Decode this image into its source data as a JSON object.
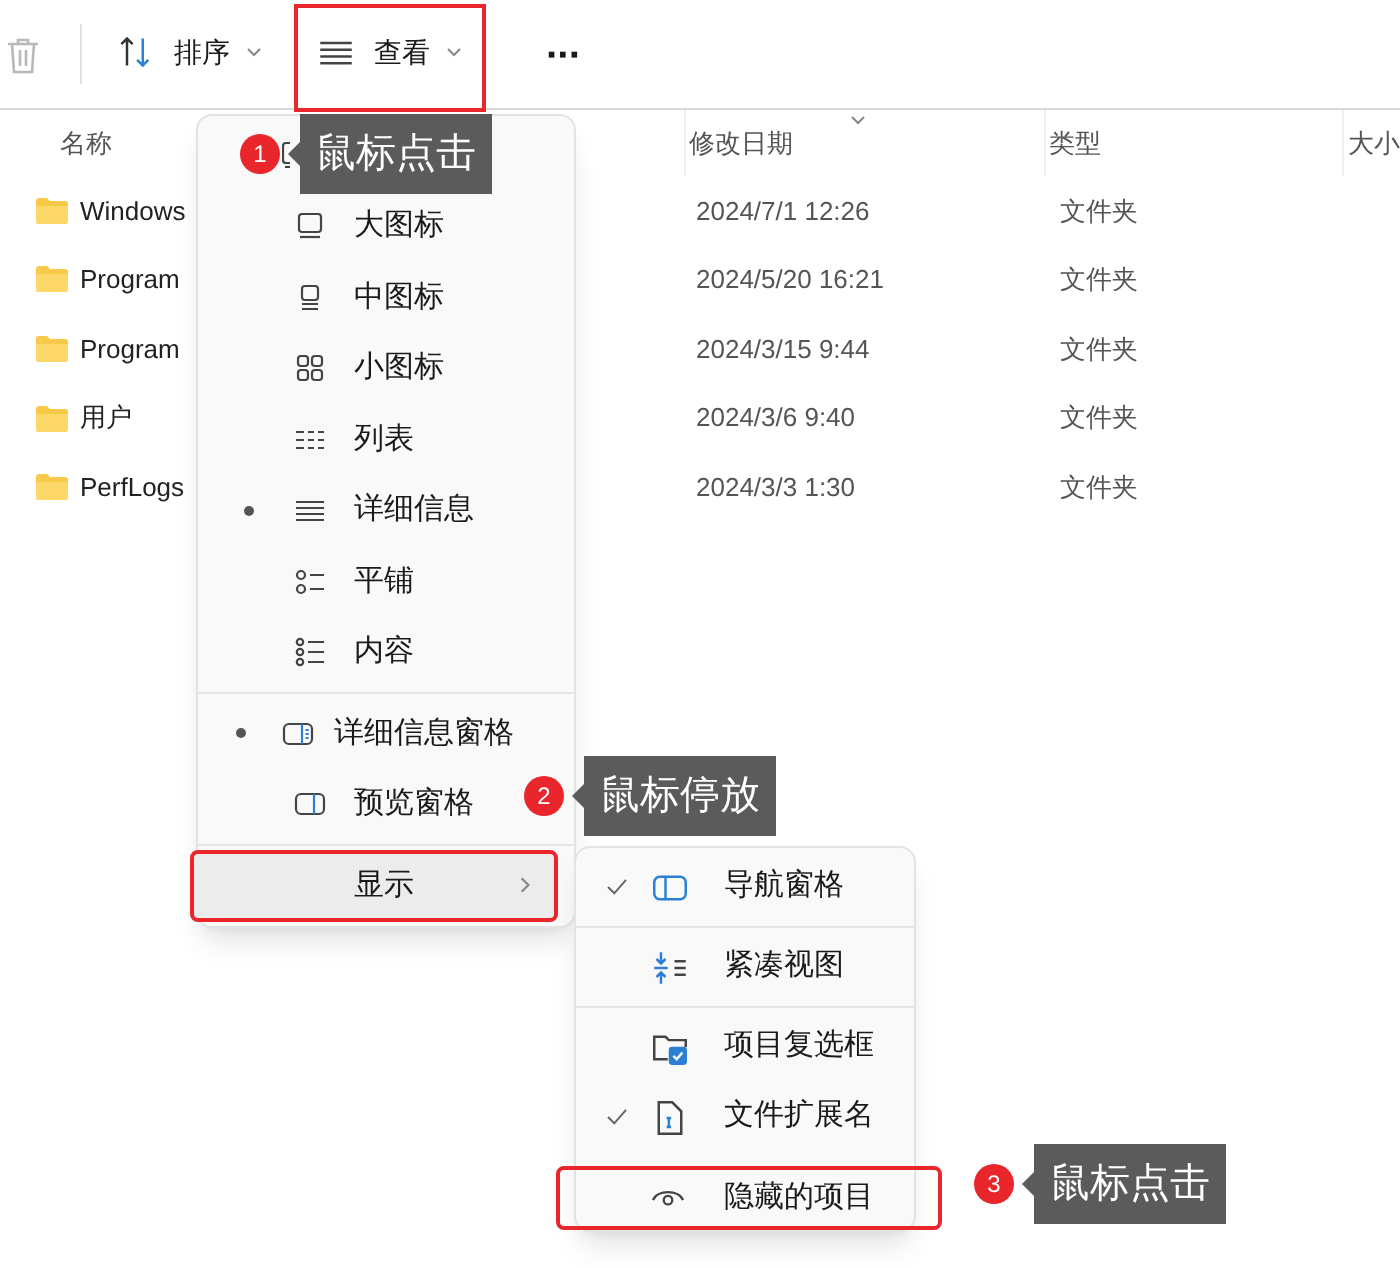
{
  "toolbar": {
    "buttons": [
      {
        "kind": "sort",
        "label": "排序",
        "highlighted": false
      },
      {
        "kind": "view",
        "label": "查看",
        "highlighted": true
      },
      {
        "kind": "more",
        "label": "···",
        "highlighted": false
      }
    ]
  },
  "table": {
    "columns": [
      {
        "label": "名称",
        "sorted": false
      },
      {
        "label": "修改日期",
        "sorted": true
      },
      {
        "label": "类型",
        "sorted": false
      },
      {
        "label": "大小",
        "sorted": false
      }
    ],
    "rows": [
      {
        "name": "Windows",
        "modified": "2024/7/1 12:26",
        "type": "文件夹"
      },
      {
        "name": "Program",
        "modified": "2024/5/20 16:21",
        "type": "文件夹"
      },
      {
        "name": "Program",
        "modified": "2024/3/15 9:44",
        "type": "文件夹"
      },
      {
        "name": "用户",
        "modified": "2024/3/6 9:40",
        "type": "文件夹"
      },
      {
        "name": "PerfLogs",
        "modified": "2024/3/3 1:30",
        "type": "文件夹"
      }
    ]
  },
  "view_menu": {
    "groups": [
      {
        "items": [
          {
            "kind": "extra-large"
          },
          {
            "kind": "large",
            "label": "大图标",
            "selected": false
          },
          {
            "kind": "medium",
            "label": "中图标",
            "selected": false
          },
          {
            "kind": "small",
            "label": "小图标",
            "selected": false
          },
          {
            "kind": "list",
            "label": "列表",
            "selected": false
          },
          {
            "kind": "details",
            "label": "详细信息",
            "selected": true
          },
          {
            "kind": "tiles",
            "label": "平铺",
            "selected": false
          },
          {
            "kind": "content",
            "label": "内容",
            "selected": false
          }
        ]
      },
      {
        "items": [
          {
            "kind": "details-pane",
            "label": "详细信息窗格",
            "selected": true
          },
          {
            "kind": "preview-pane",
            "label": "预览窗格",
            "selected": false
          }
        ]
      },
      {
        "items": [
          {
            "kind": "show",
            "label": "显示",
            "selected": false,
            "highlighted": true
          }
        ]
      }
    ]
  },
  "show_menu": {
    "groups": [
      {
        "items": [
          {
            "kind": "navigation",
            "label": "导航窗格",
            "checked": true,
            "highlighted": false
          }
        ]
      },
      {
        "items": [
          {
            "kind": "compact",
            "label": "紧凑视图",
            "checked": false,
            "highlighted": false
          }
        ]
      },
      {
        "items": [
          {
            "kind": "checkboxes",
            "label": "项目复选框",
            "checked": false,
            "highlighted": false
          },
          {
            "kind": "extensions",
            "label": "文件扩展名",
            "checked": true,
            "highlighted": false
          },
          {
            "kind": "hidden",
            "label": "隐藏的项目",
            "checked": false,
            "highlighted": true
          }
        ]
      }
    ]
  },
  "annotations": [
    {
      "number": "1",
      "text": "鼠标点击"
    },
    {
      "number": "2",
      "text": "鼠标停放"
    },
    {
      "number": "3",
      "text": "鼠标点击"
    }
  ]
}
